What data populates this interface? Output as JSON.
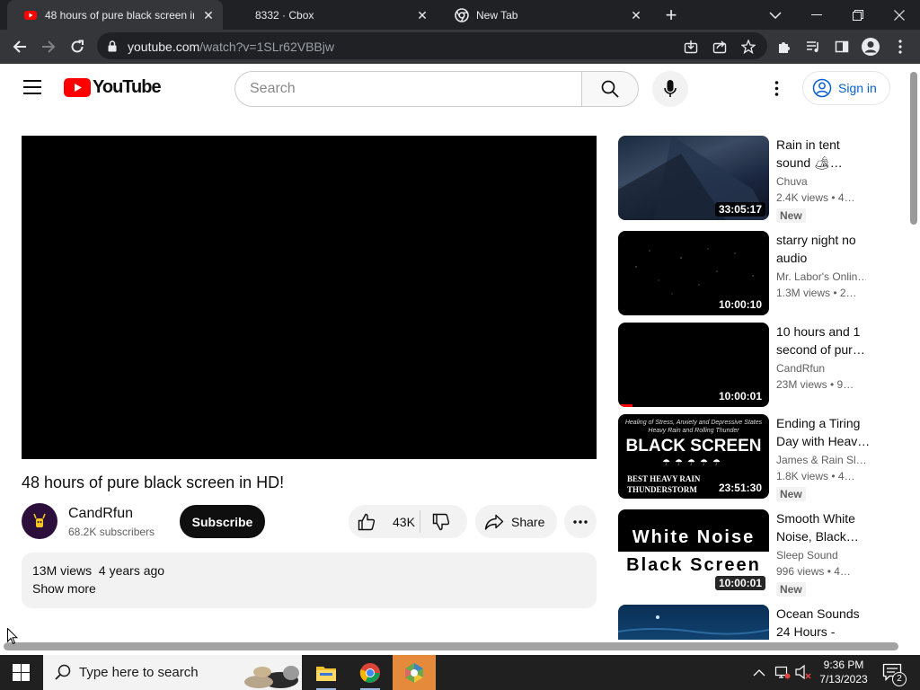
{
  "browser": {
    "tabs": [
      {
        "title": "48 hours of pure black screen in HD!",
        "active": true
      },
      {
        "title": "8332 · Cbox",
        "active": false
      },
      {
        "title": "New Tab",
        "active": false
      }
    ],
    "url_host": "youtube.com",
    "url_path": "/watch?v=1SLr62VBBjw"
  },
  "youtube": {
    "logo_text": "YouTube",
    "search_placeholder": "Search",
    "signin_label": "Sign in",
    "video": {
      "title": "48 hours of pure black screen in HD!",
      "channel": "CandRfun",
      "subscribers": "68.2K subscribers",
      "subscribe_label": "Subscribe",
      "likes": "43K",
      "share_label": "Share",
      "views": "13M views",
      "age": "4 years ago",
      "show_more": "Show more"
    },
    "recommendations": [
      {
        "title_l1": "Rain in tent",
        "title_l2": "sound 🏕…",
        "channel": "Chuva",
        "views": "2.4K views  •  4…",
        "duration": "33:05:17",
        "badge": "New"
      },
      {
        "title_l1": "starry night no",
        "title_l2": "audio",
        "channel": "Mr. Labor's Onlin…",
        "views": "1.3M views  •  2…",
        "duration": "10:00:10",
        "badge": ""
      },
      {
        "title_l1": "10 hours and 1",
        "title_l2": "second of pur…",
        "channel": "CandRfun",
        "views": "23M views  •  9…",
        "duration": "10:00:01",
        "badge": ""
      },
      {
        "title_l1": "Ending a Tiring",
        "title_l2": "Day with Heav…",
        "channel": "James & Rain Sl…",
        "views": "1.8K views  •  4…",
        "duration": "23:51:30",
        "badge": "New",
        "thumb_top": "Healing of Stress, Anxiety and Depressive States",
        "thumb_top2": "Heavy Rain and Rolling Thunder",
        "thumb_main": "BLACK SCREEN",
        "thumb_bottom": "BEST HEAVY RAIN",
        "thumb_bottom2": "THUNDERSTORM"
      },
      {
        "title_l1": "Smooth White",
        "title_l2": "Noise, Black…",
        "channel": "Sleep Sound",
        "views": "996 views  •  4…",
        "duration": "10:00:01",
        "badge": "New",
        "thumb_line1": "White Noise",
        "thumb_line2": "Black Screen"
      },
      {
        "title_l1": "Ocean Sounds",
        "title_l2": "24 Hours -",
        "channel": "",
        "views": "",
        "duration": "",
        "badge": ""
      }
    ]
  },
  "taskbar": {
    "search_placeholder": "Type here to search",
    "time": "9:36 PM",
    "date": "7/13/2023",
    "notifications": "2"
  },
  "colors": {
    "youtube_red": "#ff0000",
    "link_blue": "#065fd4",
    "chrome_dark": "#202124"
  }
}
